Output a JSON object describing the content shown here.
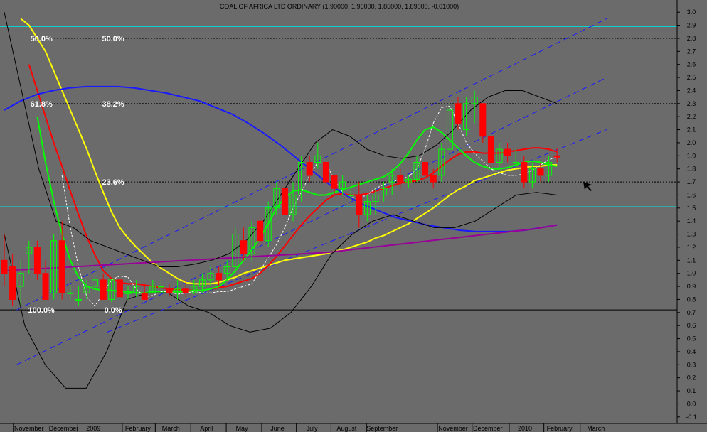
{
  "chart_data": {
    "type": "candlestick",
    "title": "COAL OF AFRICA LTD ORDINARY (1.90000, 1.96000, 1.85000, 1.89000, -0.01000)",
    "ylim": [
      -0.15,
      3.05
    ],
    "y_ticks": [
      -0.1,
      0.0,
      0.1,
      0.2,
      0.3,
      0.4,
      0.5,
      0.6,
      0.7,
      0.8,
      0.9,
      1.0,
      1.1,
      1.2,
      1.3,
      1.4,
      1.5,
      1.6,
      1.7,
      1.8,
      1.9,
      2.0,
      2.1,
      2.2,
      2.3,
      2.4,
      2.5,
      2.6,
      2.7,
      2.8,
      2.9,
      3.0
    ],
    "y_tick_labels": [
      "-0.1",
      "0.0",
      "0.1",
      "0.2",
      "0.3",
      "0.4",
      "0.5",
      "0.6",
      "0.7",
      "0.8",
      "0.9",
      "1.0",
      "1.1",
      "1.2",
      "1.3",
      "1.4",
      "1.5",
      "1.6",
      "1.7",
      "1.8",
      "1.9",
      "2.0",
      "2.1",
      "2.2",
      "2.3",
      "2.4",
      "2.5",
      "2.6",
      "2.7",
      "2.8",
      "2.9",
      "3.0"
    ],
    "x_labels": [
      {
        "label": "November",
        "i": 3
      },
      {
        "label": "December",
        "i": 7.2
      },
      {
        "label": "2009",
        "i": 10.8
      },
      {
        "label": "February",
        "i": 16.2
      },
      {
        "label": "March",
        "i": 20.2
      },
      {
        "label": "April",
        "i": 24.5
      },
      {
        "label": "May",
        "i": 28.8
      },
      {
        "label": "June",
        "i": 33.1
      },
      {
        "label": "July",
        "i": 37.3
      },
      {
        "label": "August",
        "i": 41.5
      },
      {
        "label": "September",
        "i": 45.8
      },
      {
        "label": "November",
        "i": 54.4
      },
      {
        "label": "December",
        "i": 58.6
      },
      {
        "label": "2010",
        "i": 63.1
      },
      {
        "label": "February",
        "i": 67.3
      },
      {
        "label": "March",
        "i": 71.7
      }
    ],
    "candles": [
      {
        "o": 1.1,
        "h": 1.3,
        "l": 0.9,
        "c": 1.0
      },
      {
        "o": 1.05,
        "h": 1.15,
        "l": 0.75,
        "c": 0.8
      },
      {
        "o": 0.9,
        "h": 1.1,
        "l": 0.75,
        "c": 1.0
      },
      {
        "o": 1.15,
        "h": 1.25,
        "l": 1.0,
        "c": 1.2
      },
      {
        "o": 1.2,
        "h": 1.25,
        "l": 0.95,
        "c": 1.0
      },
      {
        "o": 1.0,
        "h": 1.1,
        "l": 0.85,
        "c": 0.8
      },
      {
        "o": 0.85,
        "h": 1.3,
        "l": 0.8,
        "c": 1.25
      },
      {
        "o": 1.25,
        "h": 1.4,
        "l": 0.8,
        "c": 0.85
      },
      {
        "o": 0.85,
        "h": 0.9,
        "l": 0.8,
        "c": 0.85
      },
      {
        "o": 0.8,
        "h": 0.9,
        "l": 0.75,
        "c": 0.8
      },
      {
        "o": 0.85,
        "h": 0.95,
        "l": 0.8,
        "c": 0.9
      },
      {
        "o": 0.9,
        "h": 1.0,
        "l": 0.85,
        "c": 0.95
      },
      {
        "o": 0.95,
        "h": 1.0,
        "l": 0.8,
        "c": 0.8
      },
      {
        "o": 0.8,
        "h": 0.95,
        "l": 0.78,
        "c": 0.95
      },
      {
        "o": 0.95,
        "h": 0.95,
        "l": 0.82,
        "c": 0.82
      },
      {
        "o": 0.85,
        "h": 0.9,
        "l": 0.8,
        "c": 0.85
      },
      {
        "o": 0.85,
        "h": 0.95,
        "l": 0.82,
        "c": 0.9
      },
      {
        "o": 0.85,
        "h": 0.92,
        "l": 0.8,
        "c": 0.8
      },
      {
        "o": 0.85,
        "h": 0.95,
        "l": 0.85,
        "c": 0.9
      },
      {
        "o": 0.9,
        "h": 1.0,
        "l": 0.88,
        "c": 0.9
      },
      {
        "o": 0.88,
        "h": 0.92,
        "l": 0.82,
        "c": 0.85
      },
      {
        "o": 0.85,
        "h": 0.95,
        "l": 0.8,
        "c": 0.88
      },
      {
        "o": 0.88,
        "h": 0.95,
        "l": 0.82,
        "c": 0.85
      },
      {
        "o": 0.85,
        "h": 0.95,
        "l": 0.84,
        "c": 0.9
      },
      {
        "o": 0.9,
        "h": 1.0,
        "l": 0.85,
        "c": 0.95
      },
      {
        "o": 0.95,
        "h": 1.05,
        "l": 0.9,
        "c": 1.0
      },
      {
        "o": 1.0,
        "h": 1.05,
        "l": 0.9,
        "c": 0.95
      },
      {
        "o": 1.0,
        "h": 1.1,
        "l": 0.95,
        "c": 1.05
      },
      {
        "o": 1.05,
        "h": 1.35,
        "l": 1.0,
        "c": 1.3
      },
      {
        "o": 1.25,
        "h": 1.35,
        "l": 1.1,
        "c": 1.15
      },
      {
        "o": 1.15,
        "h": 1.4,
        "l": 1.1,
        "c": 1.35
      },
      {
        "o": 1.4,
        "h": 1.45,
        "l": 1.2,
        "c": 1.25
      },
      {
        "o": 1.25,
        "h": 1.55,
        "l": 1.2,
        "c": 1.5
      },
      {
        "o": 1.5,
        "h": 1.7,
        "l": 1.45,
        "c": 1.65
      },
      {
        "o": 1.65,
        "h": 1.7,
        "l": 1.4,
        "c": 1.45
      },
      {
        "o": 1.45,
        "h": 1.7,
        "l": 1.4,
        "c": 1.6
      },
      {
        "o": 1.6,
        "h": 1.9,
        "l": 1.55,
        "c": 1.85
      },
      {
        "o": 1.85,
        "h": 1.9,
        "l": 1.7,
        "c": 1.75
      },
      {
        "o": 1.85,
        "h": 2.0,
        "l": 1.8,
        "c": 1.9
      },
      {
        "o": 1.85,
        "h": 1.85,
        "l": 1.65,
        "c": 1.7
      },
      {
        "o": 1.75,
        "h": 1.75,
        "l": 1.6,
        "c": 1.65
      },
      {
        "o": 1.65,
        "h": 1.75,
        "l": 1.6,
        "c": 1.7
      },
      {
        "o": 1.6,
        "h": 1.65,
        "l": 1.55,
        "c": 1.6
      },
      {
        "o": 1.6,
        "h": 1.7,
        "l": 1.35,
        "c": 1.45
      },
      {
        "o": 1.45,
        "h": 1.6,
        "l": 1.4,
        "c": 1.55
      },
      {
        "o": 1.55,
        "h": 1.65,
        "l": 1.45,
        "c": 1.6
      },
      {
        "o": 1.6,
        "h": 1.7,
        "l": 1.55,
        "c": 1.65
      },
      {
        "o": 1.7,
        "h": 1.8,
        "l": 1.6,
        "c": 1.75
      },
      {
        "o": 1.75,
        "h": 1.8,
        "l": 1.65,
        "c": 1.7
      },
      {
        "o": 1.7,
        "h": 1.75,
        "l": 1.65,
        "c": 1.72
      },
      {
        "o": 1.72,
        "h": 1.9,
        "l": 1.7,
        "c": 1.85
      },
      {
        "o": 1.85,
        "h": 1.9,
        "l": 1.7,
        "c": 1.75
      },
      {
        "o": 1.75,
        "h": 1.8,
        "l": 1.65,
        "c": 1.7
      },
      {
        "o": 1.75,
        "h": 2.0,
        "l": 1.7,
        "c": 1.95
      },
      {
        "o": 1.95,
        "h": 2.3,
        "l": 1.9,
        "c": 2.25
      },
      {
        "o": 2.3,
        "h": 2.35,
        "l": 2.1,
        "c": 2.15
      },
      {
        "o": 2.1,
        "h": 2.35,
        "l": 2.05,
        "c": 2.3
      },
      {
        "o": 2.3,
        "h": 2.4,
        "l": 2.15,
        "c": 2.35
      },
      {
        "o": 2.3,
        "h": 2.3,
        "l": 2.0,
        "c": 2.05
      },
      {
        "o": 2.05,
        "h": 2.1,
        "l": 1.8,
        "c": 1.85
      },
      {
        "o": 1.85,
        "h": 2.0,
        "l": 1.8,
        "c": 1.95
      },
      {
        "o": 1.95,
        "h": 2.0,
        "l": 1.85,
        "c": 1.9
      },
      {
        "o": 1.85,
        "h": 1.95,
        "l": 1.8,
        "c": 1.85
      },
      {
        "o": 1.85,
        "h": 1.9,
        "l": 1.65,
        "c": 1.7
      },
      {
        "o": 1.7,
        "h": 1.85,
        "l": 1.65,
        "c": 1.8
      },
      {
        "o": 1.8,
        "h": 1.85,
        "l": 1.7,
        "c": 1.75
      },
      {
        "o": 1.75,
        "h": 1.9,
        "l": 1.7,
        "c": 1.85
      },
      {
        "o": 1.9,
        "h": 1.96,
        "l": 1.85,
        "c": 1.89
      }
    ],
    "series": [
      {
        "color": "#ffff00",
        "values": [
          2.95,
          2.9,
          2.8,
          2.7,
          2.55,
          2.4,
          2.25,
          2.1,
          1.95,
          1.78,
          1.62,
          1.47,
          1.35,
          1.27,
          1.2,
          1.14,
          1.08,
          1.04,
          1.0,
          0.96,
          0.93,
          0.92,
          0.92,
          0.92,
          0.93,
          0.95,
          0.97,
          1.0,
          1.02,
          1.04,
          1.06,
          1.08,
          1.1,
          1.11,
          1.12,
          1.13,
          1.14,
          1.15,
          1.17,
          1.18,
          1.2,
          1.22,
          1.24,
          1.27,
          1.29,
          1.32,
          1.35,
          1.38,
          1.42,
          1.46,
          1.5,
          1.55,
          1.6,
          1.64,
          1.67,
          1.71,
          1.73,
          1.75,
          1.77,
          1.79,
          1.8,
          1.81,
          1.82,
          1.82,
          1.83,
          1.83
        ]
      },
      {
        "color": "#ff0000",
        "values": [
          2.6,
          2.4,
          2.2,
          2.0,
          1.82,
          1.63,
          1.45,
          1.28,
          1.14,
          1.02,
          0.96,
          0.93,
          0.92,
          0.92,
          0.91,
          0.9,
          0.89,
          0.88,
          0.88,
          0.87,
          0.87,
          0.87,
          0.88,
          0.89,
          0.9,
          0.92,
          0.94,
          0.96,
          1.0,
          1.06,
          1.13,
          1.21,
          1.29,
          1.37,
          1.44,
          1.5,
          1.56,
          1.6,
          1.61,
          1.6,
          1.6,
          1.61,
          1.63,
          1.65,
          1.67,
          1.69,
          1.7,
          1.71,
          1.73,
          1.77,
          1.82,
          1.87,
          1.91,
          1.93,
          1.93,
          1.92,
          1.92,
          1.92,
          1.93,
          1.94,
          1.95,
          1.96,
          1.96,
          1.95,
          1.93
        ]
      },
      {
        "color": "#00ff00",
        "values": [
          2.2,
          1.85,
          1.55,
          1.3,
          1.1,
          0.97,
          0.9,
          0.88,
          0.87,
          0.87,
          0.86,
          0.86,
          0.85,
          0.85,
          0.86,
          0.86,
          0.86,
          0.86,
          0.86,
          0.87,
          0.87,
          0.88,
          0.9,
          0.95,
          1.02,
          1.1,
          1.18,
          1.27,
          1.38,
          1.5,
          1.58,
          1.63,
          1.64,
          1.62,
          1.6,
          1.6,
          1.62,
          1.64,
          1.66,
          1.68,
          1.7,
          1.72,
          1.74,
          1.78,
          1.84,
          1.92,
          2.02,
          2.1,
          2.12,
          2.08,
          2.02,
          1.96,
          1.9,
          1.85,
          1.82,
          1.8,
          1.8,
          1.81,
          1.83,
          1.85,
          1.86,
          1.85,
          1.83,
          1.82
        ]
      },
      {
        "color": "#ffffff",
        "dashed": true,
        "values": [
          1.75,
          1.35,
          1.05,
          0.82,
          0.75,
          0.85,
          0.95,
          0.98,
          0.97,
          0.88,
          0.82,
          0.83,
          0.86,
          0.86,
          0.84,
          0.85,
          0.86,
          0.85,
          0.85,
          0.86,
          0.86,
          0.88,
          0.9,
          0.92,
          1.02,
          1.12,
          1.22,
          1.35,
          1.5,
          1.62,
          1.75,
          1.85,
          1.84,
          1.72,
          1.62,
          1.58,
          1.58,
          1.6,
          1.65,
          1.68,
          1.7,
          1.72,
          1.74,
          1.8,
          1.95,
          2.15,
          2.27,
          2.28,
          2.15,
          2.0,
          1.92,
          1.86,
          1.8,
          1.77,
          1.75,
          1.75,
          1.76,
          1.79,
          1.83,
          1.87,
          1.89
        ]
      },
      {
        "color": "#1a1aff",
        "values": [
          2.25,
          2.32,
          2.37,
          2.4,
          2.42,
          2.43,
          2.43,
          2.43,
          2.42,
          2.4,
          2.38,
          2.35,
          2.32,
          2.27,
          2.22,
          2.15,
          2.07,
          1.98,
          1.88,
          1.78,
          1.68,
          1.6,
          1.53,
          1.48,
          1.43,
          1.4,
          1.37,
          1.35,
          1.33,
          1.32,
          1.32,
          1.32,
          1.33,
          1.35,
          1.37
        ]
      },
      {
        "color": "#990099",
        "values": [
          1.02,
          1.03,
          1.04,
          1.05,
          1.06,
          1.07,
          1.08,
          1.09,
          1.1,
          1.11,
          1.12,
          1.13,
          1.14,
          1.15,
          1.16,
          1.18,
          1.2,
          1.22,
          1.24,
          1.26,
          1.28,
          1.3,
          1.32,
          1.34,
          1.37
        ]
      },
      {
        "color": "#000000",
        "values": [
          3.0,
          2.4,
          1.8,
          1.4,
          1.35,
          1.25,
          1.2,
          1.15,
          1.1,
          1.05,
          1.05,
          1.07,
          1.1,
          1.15,
          1.25,
          1.4,
          1.6,
          1.8,
          2.0,
          2.1,
          2.05,
          1.95,
          1.9,
          1.88,
          1.9,
          1.98,
          2.1,
          2.25,
          2.35,
          2.4,
          2.4,
          2.35,
          2.3
        ]
      },
      {
        "color": "#000000",
        "values": [
          1.3,
          0.6,
          0.3,
          0.12,
          0.12,
          0.4,
          0.8,
          0.85,
          0.85,
          0.75,
          0.7,
          0.6,
          0.55,
          0.58,
          0.7,
          0.9,
          1.15,
          1.3,
          1.4,
          1.45,
          1.4,
          1.35,
          1.35,
          1.4,
          1.5,
          1.6,
          1.62,
          1.6
        ]
      }
    ],
    "fib_levels": [
      {
        "value": 2.3
      },
      {
        "value": 2.8
      },
      {
        "value": 1.7
      }
    ],
    "hlines": [
      {
        "value": 2.89,
        "color": "#00e0e0"
      },
      {
        "value": 1.51,
        "color": "#00e0e0"
      },
      {
        "value": 0.72,
        "color": "#000000"
      },
      {
        "value": 0.13,
        "color": "#00e0e0"
      }
    ],
    "fib_labels": [
      {
        "text": "50.0%",
        "i": 4.5,
        "y": 2.8
      },
      {
        "text": "50.0%",
        "i": 13.2,
        "y": 2.8
      },
      {
        "text": "61.8%",
        "i": 4.5,
        "y": 2.3
      },
      {
        "text": "38.2%",
        "i": 13.2,
        "y": 2.3
      },
      {
        "text": "23.6%",
        "i": 13.2,
        "y": 1.7
      },
      {
        "text": "100.0%",
        "i": 4.5,
        "y": 0.72
      },
      {
        "text": "0.0%",
        "i": 13.2,
        "y": 0.72
      }
    ],
    "channel_lines": [
      {
        "from": [
          1.5,
          0.3
        ],
        "to": [
          73.0,
          2.5
        ]
      },
      {
        "from": [
          1.5,
          0.72
        ],
        "to": [
          73.0,
          2.95
        ]
      },
      {
        "from": [
          12.5,
          0.55
        ],
        "to": [
          73.0,
          2.1
        ]
      }
    ],
    "colors": {
      "background": "#6b6b6b",
      "up_candle": "#00ff00",
      "down_candle": "#ff0000",
      "fib_line": "#000000",
      "channel": "#1a1aff",
      "axis_bg": "#6b6b6b"
    }
  }
}
